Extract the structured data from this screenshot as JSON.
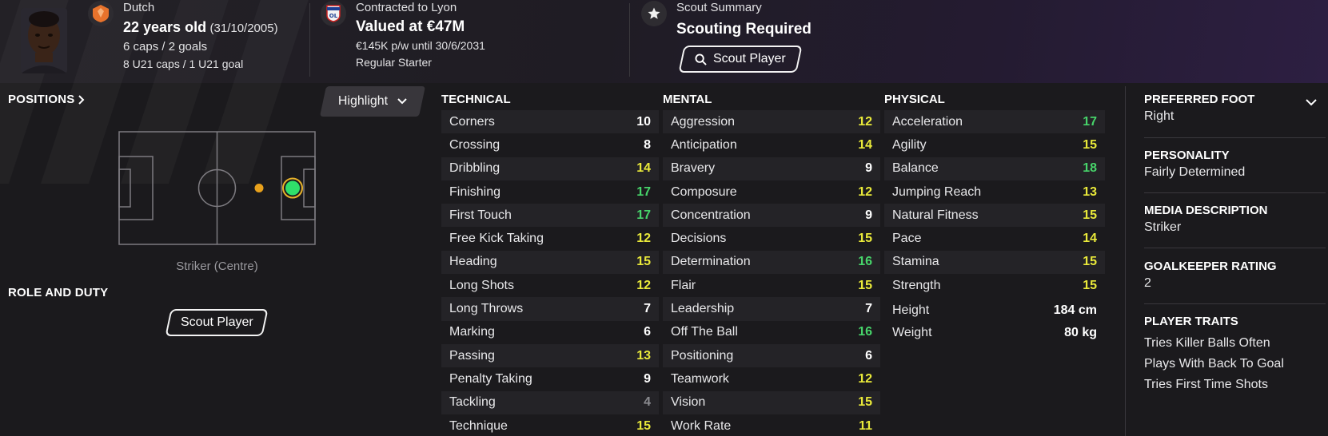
{
  "header": {
    "nationality": "Dutch",
    "age": "22 years old",
    "dob": "(31/10/2005)",
    "caps": "6 caps / 2 goals",
    "u21": "8 U21 caps / 1 U21 goal",
    "contract_title": "Contracted to Lyon",
    "value": "Valued at €47M",
    "wage": "€145K p/w until 30/6/2031",
    "status": "Regular Starter",
    "scout_title": "Scout Summary",
    "scout_status": "Scouting Required",
    "scout_button": "Scout Player"
  },
  "left": {
    "positions_title": "POSITIONS",
    "highlight_label": "Highlight",
    "position_label": "Striker (Centre)",
    "role_title": "ROLE AND DUTY",
    "role_button": "Scout Player"
  },
  "technical": {
    "title": "TECHNICAL",
    "rows": [
      {
        "name": "Corners",
        "value": "10",
        "tone": "white"
      },
      {
        "name": "Crossing",
        "value": "8",
        "tone": "white"
      },
      {
        "name": "Dribbling",
        "value": "14",
        "tone": "yellow"
      },
      {
        "name": "Finishing",
        "value": "17",
        "tone": "green"
      },
      {
        "name": "First Touch",
        "value": "17",
        "tone": "green"
      },
      {
        "name": "Free Kick Taking",
        "value": "12",
        "tone": "yellow"
      },
      {
        "name": "Heading",
        "value": "15",
        "tone": "yellow"
      },
      {
        "name": "Long Shots",
        "value": "12",
        "tone": "yellow"
      },
      {
        "name": "Long Throws",
        "value": "7",
        "tone": "white"
      },
      {
        "name": "Marking",
        "value": "6",
        "tone": "white"
      },
      {
        "name": "Passing",
        "value": "13",
        "tone": "yellow"
      },
      {
        "name": "Penalty Taking",
        "value": "9",
        "tone": "white"
      },
      {
        "name": "Tackling",
        "value": "4",
        "tone": "grey"
      },
      {
        "name": "Technique",
        "value": "15",
        "tone": "yellow"
      }
    ]
  },
  "mental": {
    "title": "MENTAL",
    "rows": [
      {
        "name": "Aggression",
        "value": "12",
        "tone": "yellow"
      },
      {
        "name": "Anticipation",
        "value": "14",
        "tone": "yellow"
      },
      {
        "name": "Bravery",
        "value": "9",
        "tone": "white"
      },
      {
        "name": "Composure",
        "value": "12",
        "tone": "yellow"
      },
      {
        "name": "Concentration",
        "value": "9",
        "tone": "white"
      },
      {
        "name": "Decisions",
        "value": "15",
        "tone": "yellow"
      },
      {
        "name": "Determination",
        "value": "16",
        "tone": "green"
      },
      {
        "name": "Flair",
        "value": "15",
        "tone": "yellow"
      },
      {
        "name": "Leadership",
        "value": "7",
        "tone": "white"
      },
      {
        "name": "Off The Ball",
        "value": "16",
        "tone": "green"
      },
      {
        "name": "Positioning",
        "value": "6",
        "tone": "white"
      },
      {
        "name": "Teamwork",
        "value": "12",
        "tone": "yellow"
      },
      {
        "name": "Vision",
        "value": "15",
        "tone": "yellow"
      },
      {
        "name": "Work Rate",
        "value": "11",
        "tone": "yellow"
      }
    ]
  },
  "physical": {
    "title": "PHYSICAL",
    "rows": [
      {
        "name": "Acceleration",
        "value": "17",
        "tone": "green"
      },
      {
        "name": "Agility",
        "value": "15",
        "tone": "yellow"
      },
      {
        "name": "Balance",
        "value": "18",
        "tone": "green"
      },
      {
        "name": "Jumping Reach",
        "value": "13",
        "tone": "yellow"
      },
      {
        "name": "Natural Fitness",
        "value": "15",
        "tone": "yellow"
      },
      {
        "name": "Pace",
        "value": "14",
        "tone": "yellow"
      },
      {
        "name": "Stamina",
        "value": "15",
        "tone": "yellow"
      },
      {
        "name": "Strength",
        "value": "15",
        "tone": "yellow"
      }
    ],
    "height_label": "Height",
    "height_value": "184 cm",
    "weight_label": "Weight",
    "weight_value": "80 kg"
  },
  "side": {
    "foot_label": "PREFERRED FOOT",
    "foot_value": "Right",
    "personality_label": "PERSONALITY",
    "personality_value": "Fairly Determined",
    "media_label": "MEDIA DESCRIPTION",
    "media_value": "Striker",
    "gk_label": "GOALKEEPER RATING",
    "gk_value": "2",
    "traits_label": "PLAYER TRAITS",
    "traits": [
      "Tries Killer Balls Often",
      "Plays With Back To Goal",
      "Tries First Time Shots"
    ]
  },
  "colors": {
    "white": "#ffffff",
    "yellow": "#e9e93a",
    "green": "#47d46a",
    "grey": "#8a8a8f",
    "position_dot": "#2fe06a",
    "position_ring": "#e8b32a"
  },
  "icons": [
    "nation-badge-icon",
    "lyon-crest-icon",
    "star-icon",
    "search-icon",
    "chevron-right-icon",
    "chevron-down-icon"
  ]
}
